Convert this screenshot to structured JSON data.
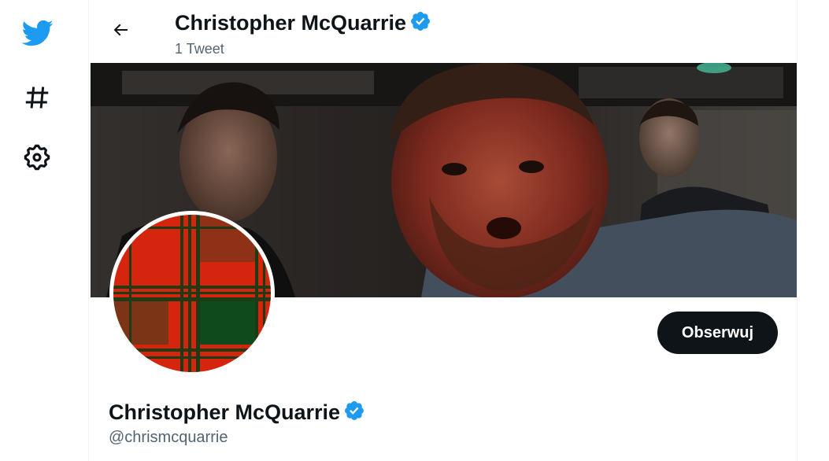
{
  "icons": {
    "logo": "twitter-bird-icon",
    "explore": "hashtag-icon",
    "settings": "gear-icon",
    "back": "arrow-left-icon",
    "verified": "verified-badge-icon"
  },
  "colors": {
    "brand": "#1d9bf0",
    "text_primary": "#0f1419",
    "text_secondary": "#536471",
    "button_dark": "#0f1419",
    "button_text": "#ffffff"
  },
  "header": {
    "name": "Christopher McQuarrie",
    "tweet_count": "1 Tweet"
  },
  "profile": {
    "name": "Christopher McQuarrie",
    "handle": "@chrismcquarrie",
    "follow_label": "Obserwuj"
  }
}
